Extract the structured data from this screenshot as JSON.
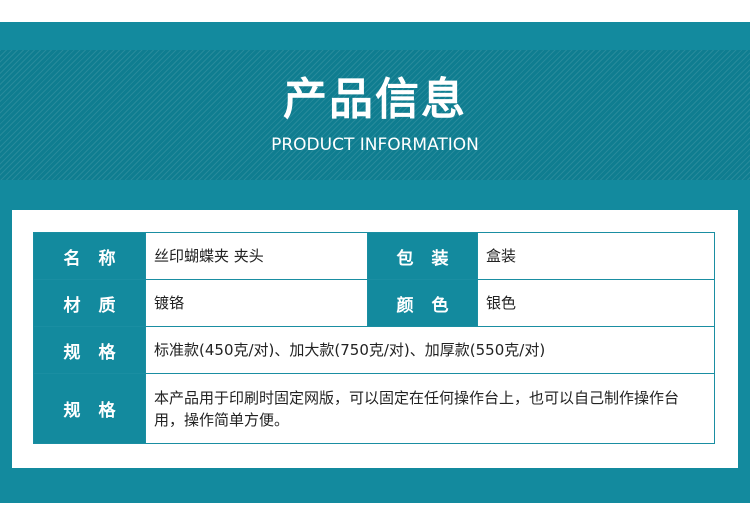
{
  "header": {
    "title": "产品信息",
    "subtitle": "PRODUCT INFORMATION"
  },
  "specs": {
    "name_label": "名 称",
    "name_value": "丝印蝴蝶夹 夹头",
    "packing_label": "包 装",
    "packing_value": "盒装",
    "material_label": "材 质",
    "material_value": "镀铬",
    "color_label": "颜 色",
    "color_value": "银色",
    "spec_label": "规 格",
    "spec_value": "标准款(450克/对)、加大款(750克/对)、加厚款(550克/对)",
    "usage_label": "规 格",
    "usage_value": "本产品用于印刷时固定网版，可以固定在任何操作台上，也可以自己制作操作台用，操作简单方便。"
  },
  "colors": {
    "teal_frame": "#138a9e",
    "header_bg": "#0f7d90",
    "label_bg": "#138a9e"
  }
}
